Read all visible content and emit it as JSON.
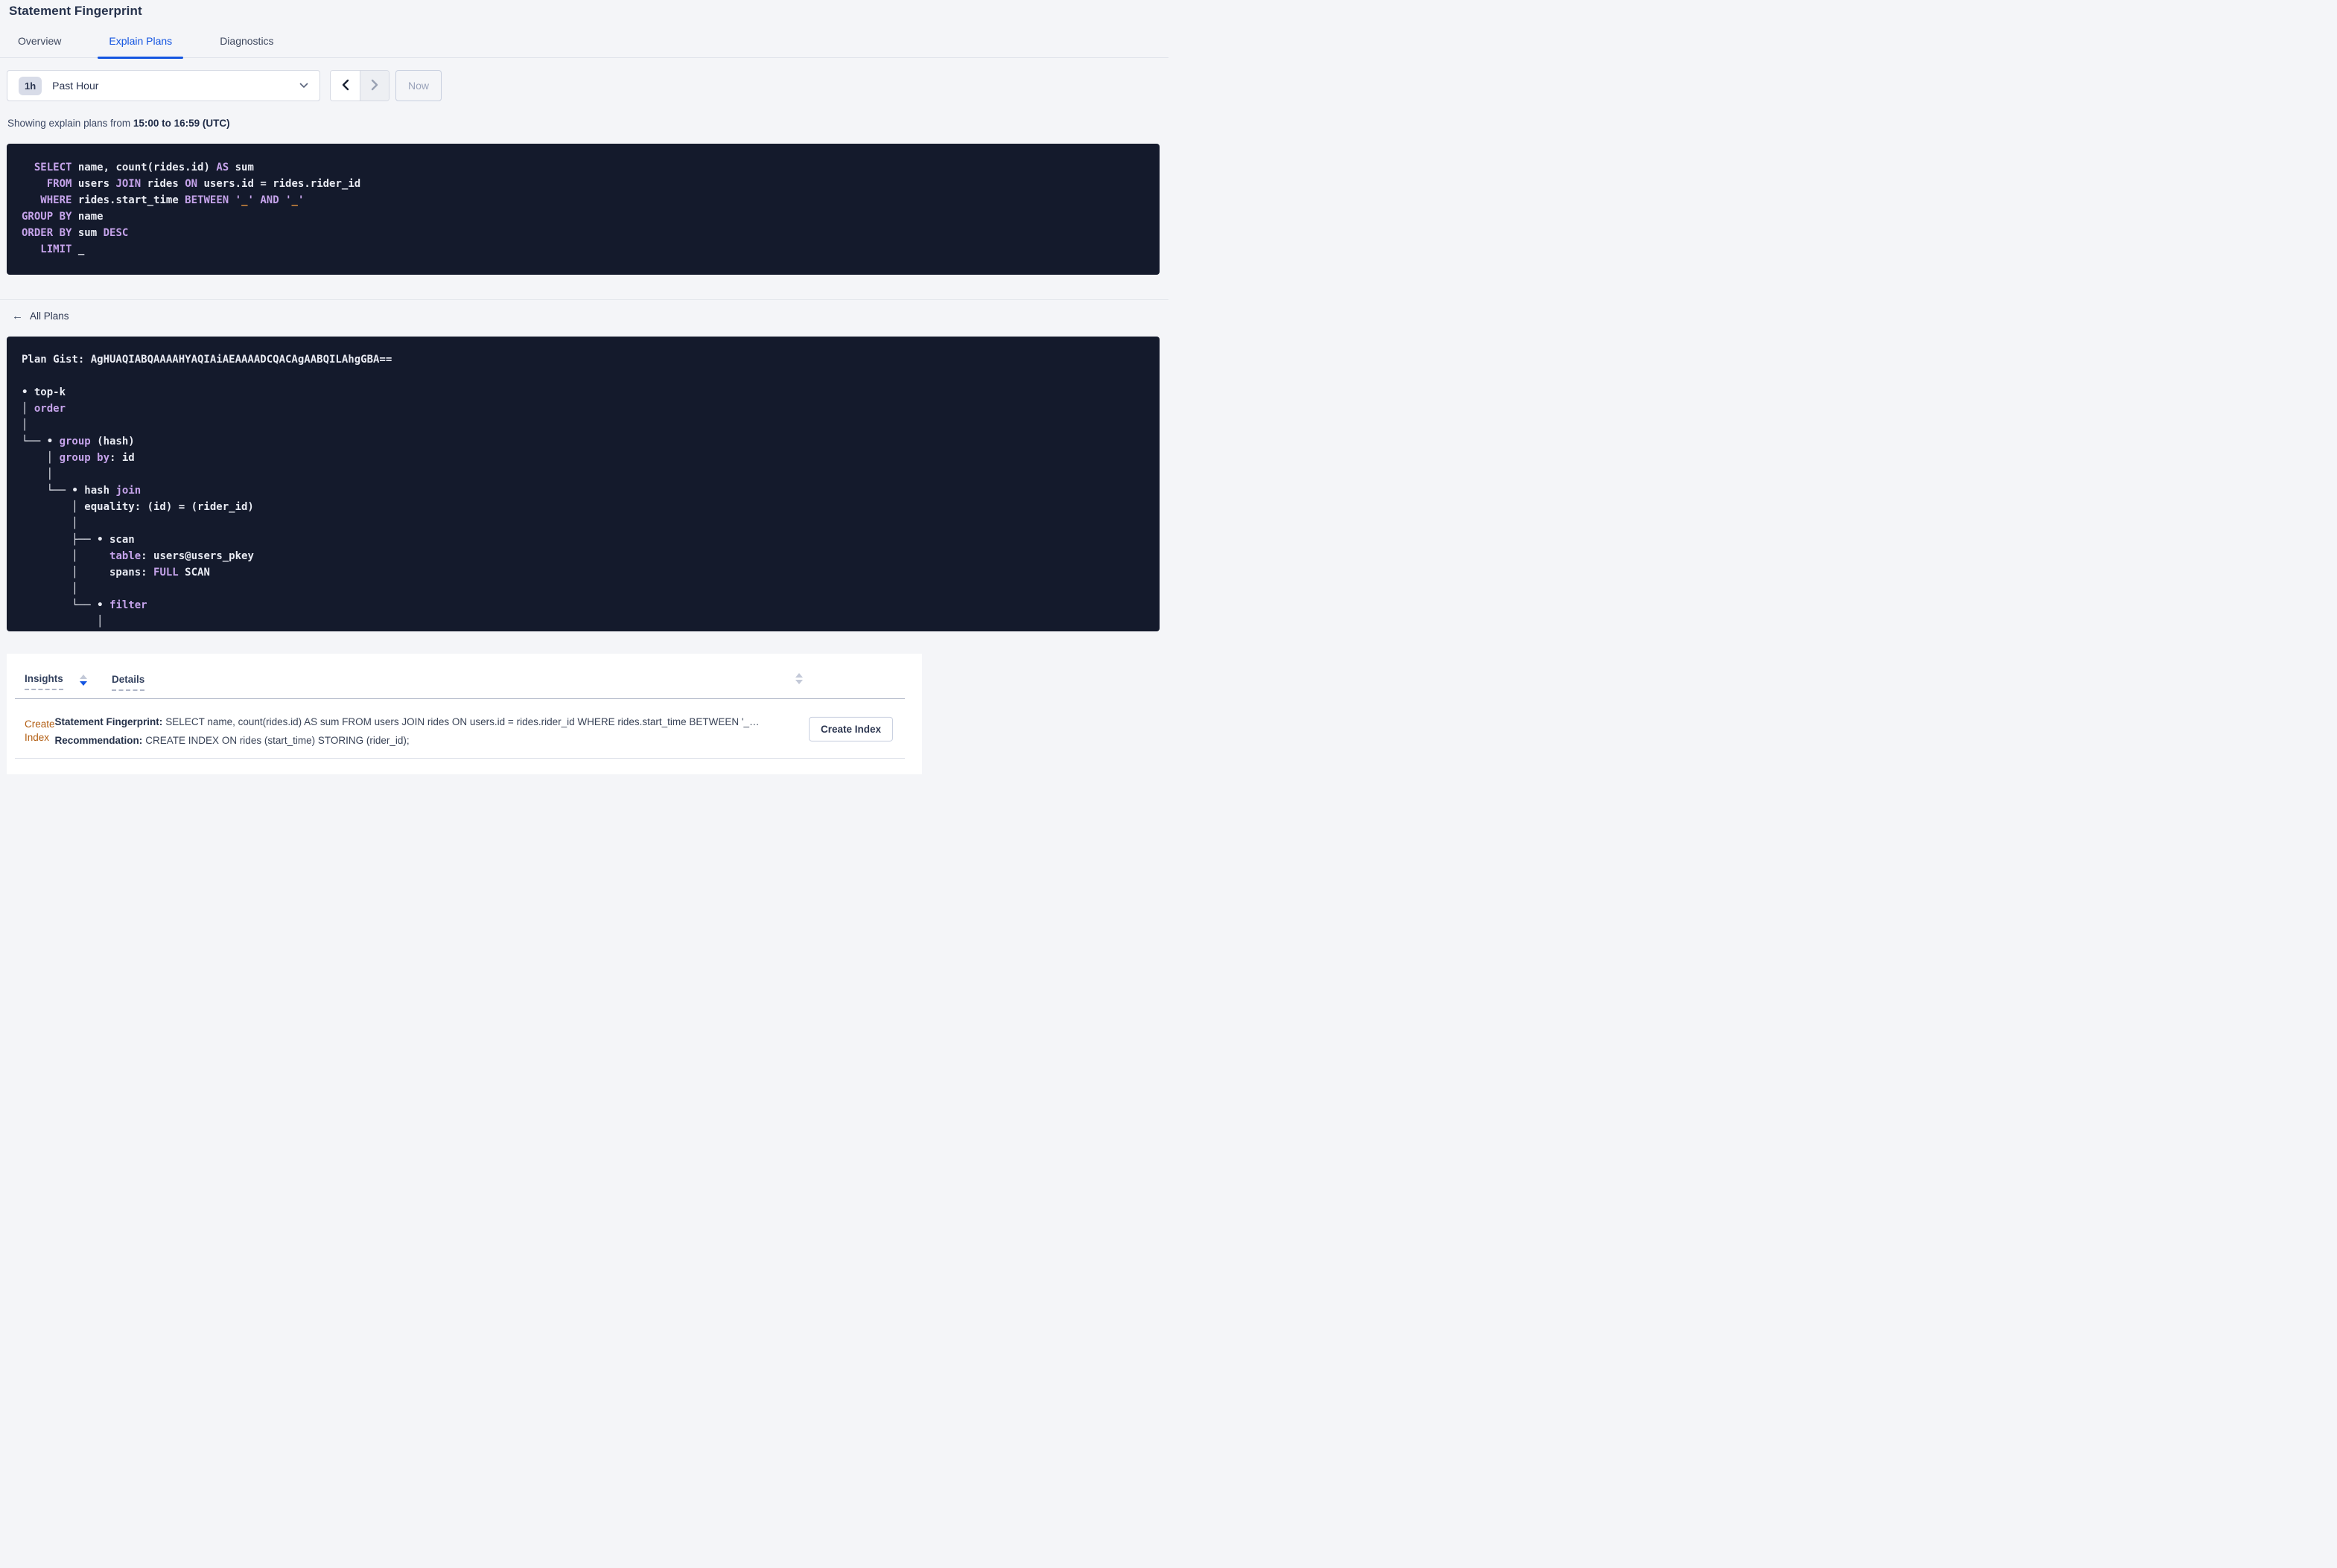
{
  "page": {
    "title": "Statement Fingerprint"
  },
  "tabs": [
    {
      "label": "Overview"
    },
    {
      "label": "Explain Plans"
    },
    {
      "label": "Diagnostics"
    }
  ],
  "active_tab": "Explain Plans",
  "time_picker": {
    "badge": "1h",
    "label": "Past Hour",
    "now_label": "Now",
    "icons": [
      "chevron-down-icon",
      "chevron-left-icon",
      "chevron-right-icon"
    ]
  },
  "status_line": {
    "prefix": "Showing explain plans from ",
    "range": "15:00 to 16:59 (UTC)"
  },
  "sql_block": {
    "lines": [
      [
        [
          "  ",
          "pl"
        ],
        [
          "SELECT",
          "kw"
        ],
        [
          " name, count(rides.id) ",
          "pl"
        ],
        [
          "AS",
          "kw"
        ],
        [
          " sum",
          "pl"
        ]
      ],
      [
        [
          "    ",
          "pl"
        ],
        [
          "FROM",
          "kw"
        ],
        [
          " users ",
          "pl"
        ],
        [
          "JOIN",
          "kw"
        ],
        [
          " rides ",
          "pl"
        ],
        [
          "ON",
          "kw"
        ],
        [
          " users.id = rides.rider_id",
          "pl"
        ]
      ],
      [
        [
          "   ",
          "pl"
        ],
        [
          "WHERE",
          "kw"
        ],
        [
          " rides.start_time ",
          "pl"
        ],
        [
          "BETWEEN",
          "kw"
        ],
        [
          " ",
          "pl"
        ],
        [
          "'",
          "kw"
        ],
        [
          "_",
          "or"
        ],
        [
          "'",
          "kw"
        ],
        [
          " ",
          "pl"
        ],
        [
          "AND",
          "kw"
        ],
        [
          " ",
          "pl"
        ],
        [
          "'",
          "kw"
        ],
        [
          "_",
          "or"
        ],
        [
          "'",
          "kw"
        ]
      ],
      [
        [
          "GROUP BY",
          "kw"
        ],
        [
          " name",
          "pl"
        ]
      ],
      [
        [
          "ORDER BY",
          "kw"
        ],
        [
          " sum ",
          "pl"
        ],
        [
          "DESC",
          "kw"
        ]
      ],
      [
        [
          "   ",
          "pl"
        ],
        [
          "LIMIT",
          "kw"
        ],
        [
          " _",
          "pl"
        ]
      ]
    ]
  },
  "back_link": {
    "label": "All Plans",
    "icon": "arrow-left-icon"
  },
  "plan_block": {
    "lines": [
      [
        [
          "Plan Gist: AgHUAQIABQAAAAHYAQIAiAEAAAADCQACAgAABQILAhgGBA==",
          "pl"
        ]
      ],
      [],
      [
        [
          "• top-k",
          "pl"
        ]
      ],
      [
        [
          "│ ",
          "pl"
        ],
        [
          "order",
          "kw"
        ]
      ],
      [
        [
          "│",
          "pl"
        ]
      ],
      [
        [
          "└── • ",
          "pl"
        ],
        [
          "group",
          "kw"
        ],
        [
          " (hash)",
          "pl"
        ]
      ],
      [
        [
          "    │ ",
          "pl"
        ],
        [
          "group by",
          "kw"
        ],
        [
          ": id",
          "pl"
        ]
      ],
      [
        [
          "    │",
          "pl"
        ]
      ],
      [
        [
          "    └── • hash ",
          "pl"
        ],
        [
          "join",
          "kw"
        ]
      ],
      [
        [
          "        │ equality: (id) = (rider_id)",
          "pl"
        ]
      ],
      [
        [
          "        │",
          "pl"
        ]
      ],
      [
        [
          "        ├── • scan",
          "pl"
        ]
      ],
      [
        [
          "        │     ",
          "pl"
        ],
        [
          "table",
          "kw"
        ],
        [
          ": users@users_pkey",
          "pl"
        ]
      ],
      [
        [
          "        │     spans: ",
          "pl"
        ],
        [
          "FULL",
          "kw"
        ],
        [
          " SCAN",
          "pl"
        ]
      ],
      [
        [
          "        │",
          "pl"
        ]
      ],
      [
        [
          "        └── • ",
          "pl"
        ],
        [
          "filter",
          "kw"
        ]
      ],
      [
        [
          "            │",
          "pl"
        ]
      ]
    ]
  },
  "insights_table": {
    "columns": [
      {
        "label": "Insights",
        "sort": "desc"
      },
      {
        "label": "Details",
        "sort": "none"
      }
    ],
    "rows": [
      {
        "insight": "Create Index",
        "details": [
          {
            "label": "Statement Fingerprint:",
            "text": "SELECT name, count(rides.id) AS sum FROM users JOIN rides ON users.id = rides.rider_id WHERE rides.start_time BETWEEN '_…"
          },
          {
            "label": "Recommendation:",
            "text": "CREATE INDEX ON rides (start_time) STORING (rider_id);"
          }
        ],
        "action_label": "Create Index"
      }
    ]
  },
  "colors": {
    "accent_blue": "#1455e1",
    "page_bg": "#f4f5f8",
    "code_bg": "#141a2c",
    "code_text": "#e9ebf3",
    "code_keyword": "#c5a3ea",
    "code_literal": "#ef9b3f",
    "insight_link_orange": "#b25d11"
  }
}
